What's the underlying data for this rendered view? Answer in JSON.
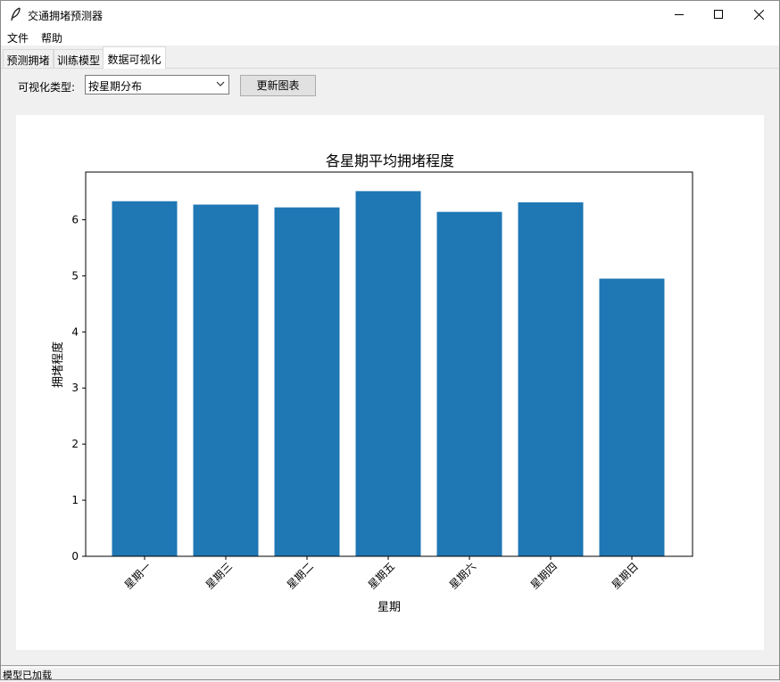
{
  "window": {
    "title": "交通拥堵预测器",
    "icons": {
      "app": "feather-icon",
      "minimize": "minimize-icon",
      "maximize": "maximize-icon",
      "close": "close-icon"
    }
  },
  "menu": {
    "items": [
      "文件",
      "帮助"
    ]
  },
  "tabs": [
    {
      "label": "预测拥堵",
      "active": false
    },
    {
      "label": "训练模型",
      "active": false
    },
    {
      "label": "数据可视化",
      "active": true
    }
  ],
  "controls": {
    "type_label": "可视化类型:",
    "type_value": "按星期分布",
    "update_button": "更新图表"
  },
  "chart_data": {
    "type": "bar",
    "title": "各星期平均拥堵程度",
    "xlabel": "星期",
    "ylabel": "拥堵程度",
    "categories": [
      "星期一",
      "星期三",
      "星期二",
      "星期五",
      "星期六",
      "星期四",
      "星期日"
    ],
    "values": [
      6.33,
      6.27,
      6.22,
      6.51,
      6.14,
      6.31,
      4.95
    ],
    "ylim": [
      0,
      6.85
    ],
    "yticks": [
      0,
      1,
      2,
      3,
      4,
      5,
      6
    ],
    "bar_color": "#1f77b4",
    "grid": false,
    "xtick_rotation": 45
  },
  "status": {
    "text": "模型已加载"
  }
}
